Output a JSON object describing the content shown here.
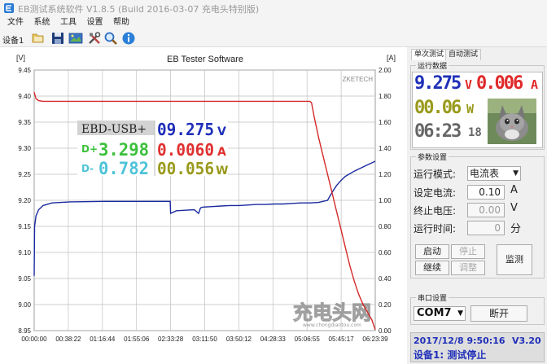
{
  "window": {
    "title": "EB测试系统软件 V1.8.5 (Build 2016-03-07 充电头特别版)"
  },
  "menu": [
    "文件",
    "系统",
    "工具",
    "设置",
    "帮助"
  ],
  "toolbar": {
    "device_label": "设备1",
    "buttons": [
      "folder-icon",
      "save-icon",
      "image-icon",
      "tools-icon",
      "search-icon",
      "info-icon"
    ]
  },
  "chart": {
    "title": "EB Tester Software",
    "left_unit": "[V]",
    "right_unit": "[A]",
    "brand": "ZKETECH",
    "left_ticks": [
      "9.45",
      "9.40",
      "9.35",
      "9.30",
      "9.25",
      "9.20",
      "9.15",
      "9.10",
      "9.05",
      "9.00",
      "8.95"
    ],
    "right_ticks": [
      "2.00",
      "1.80",
      "1.60",
      "1.40",
      "1.20",
      "1.00",
      "0.80",
      "0.60",
      "0.40",
      "0.20",
      "0.00"
    ],
    "x_ticks": [
      "00:00:00",
      "00:38:22",
      "01:16:44",
      "01:55:06",
      "02:33:28",
      "03:11:50",
      "03:50:12",
      "04:28:33",
      "05:06:55",
      "05:45:17",
      "06:23:39"
    ],
    "watermark": "充电头网",
    "watermark_sub": "www.chongdiantou.com",
    "overlay": {
      "device": "EBD-USB+",
      "voltage": "09.275",
      "voltage_unit": "V",
      "dplus_label": "D+",
      "dplus": "3.298",
      "current": "0.0060",
      "current_unit": "A",
      "dminus_label": "D-",
      "dminus": "0.782",
      "power": "00.056",
      "power_unit": "W"
    },
    "colors": {
      "voltage": "#1a2aa0",
      "current": "#d42a2a",
      "grid": "#bfbfbf"
    }
  },
  "chart_data": {
    "type": "line",
    "title": "EB Tester Software",
    "xlabel": "",
    "ylabel": "[V]",
    "y2label": "[A]",
    "xlim_min": [
      0,
      383.65
    ],
    "ylim": [
      8.95,
      9.45
    ],
    "y2lim": [
      0.0,
      2.0
    ],
    "series": [
      {
        "axis": "left",
        "x_min": [
          0,
          0.5,
          2,
          5,
          10,
          20,
          40,
          80,
          120,
          150,
          153,
          153.5,
          160,
          170,
          180,
          185,
          187,
          187.5,
          190,
          200,
          210,
          220,
          230,
          240,
          250,
          260,
          270,
          280,
          290,
          300,
          310,
          320,
          330,
          335,
          340,
          345,
          350,
          360,
          370,
          383.65
        ],
        "values": [
          9.055,
          9.15,
          9.17,
          9.182,
          9.19,
          9.195,
          9.197,
          9.198,
          9.198,
          9.198,
          9.198,
          9.175,
          9.18,
          9.181,
          9.182,
          9.175,
          9.185,
          9.186,
          9.187,
          9.188,
          9.189,
          9.19,
          9.19,
          9.191,
          9.192,
          9.192,
          9.193,
          9.193,
          9.194,
          9.195,
          9.195,
          9.196,
          9.2,
          9.215,
          9.228,
          9.238,
          9.246,
          9.256,
          9.264,
          9.275
        ]
      },
      {
        "axis": "right",
        "x_min": [
          0,
          2,
          5,
          10,
          30,
          100,
          200,
          300,
          310,
          312,
          315,
          320,
          325,
          330,
          335,
          340,
          345,
          350,
          355,
          360,
          365,
          370,
          375,
          380,
          383.65
        ],
        "values": [
          1.83,
          1.78,
          1.765,
          1.76,
          1.76,
          1.76,
          1.76,
          1.76,
          1.76,
          1.75,
          1.64,
          1.48,
          1.34,
          1.2,
          1.06,
          0.92,
          0.78,
          0.64,
          0.5,
          0.38,
          0.28,
          0.2,
          0.14,
          0.08,
          0.006
        ]
      }
    ]
  },
  "panel": {
    "tab_single": "单次测试",
    "tab_auto": "自动测试",
    "run_data_title": "运行数据",
    "voltage": "9.275",
    "voltage_unit": "V",
    "current": "0.006",
    "current_unit": "A",
    "power": "00.06",
    "power_unit": "W",
    "time_hm": "06:23",
    "time_s": "18",
    "params_title": "参数设置",
    "mode_label": "运行模式:",
    "mode_value": "电流表",
    "set_current_label": "设定电流:",
    "set_current": "0.10",
    "set_current_unit": "A",
    "end_voltage_label": "终止电压:",
    "end_voltage": "0.00",
    "end_voltage_unit": "V",
    "run_time_label": "运行时间:",
    "run_time": "0",
    "run_time_unit": "分",
    "btn_start": "启动",
    "btn_stop": "停止",
    "btn_continue": "继续",
    "btn_adjust": "调整",
    "btn_monitor": "监测",
    "serial_title": "串口设置",
    "port": "COM7",
    "btn_disconnect": "断开",
    "status_datetime": "2017/12/8 9:50:16",
    "status_version": "V3.20",
    "status_device": "设备1: 测试停止"
  }
}
